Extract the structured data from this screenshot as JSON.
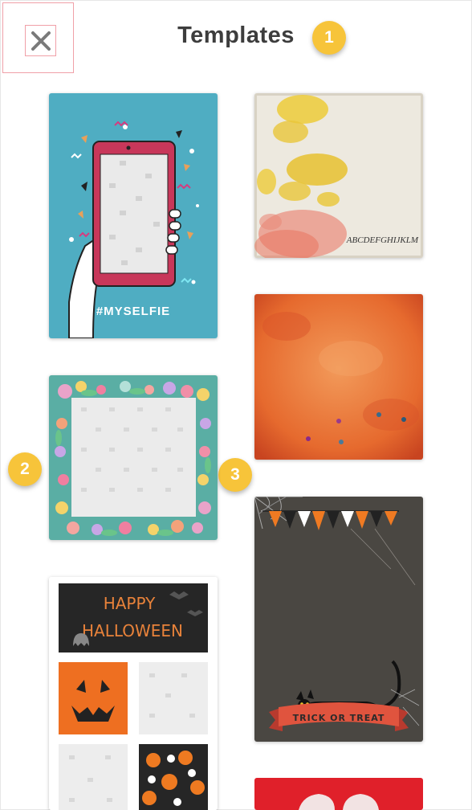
{
  "header": {
    "title": "Templates",
    "close_icon": "close-icon"
  },
  "badges": [
    "1",
    "2",
    "3"
  ],
  "templates": [
    {
      "id": "myselfie",
      "text": "#MYSELFIE",
      "bg": "#4fadc2"
    },
    {
      "id": "watercolor-alphabet",
      "text": "ABCDEFGHIJKLM",
      "bg": "#ede9df"
    },
    {
      "id": "floral-frame",
      "bg": "#5aaea4"
    },
    {
      "id": "orange-grunge",
      "bg": "#e0632a"
    },
    {
      "id": "happy-halloween-collage",
      "text_line1": "HAPPY",
      "text_line2": "HALLOWEEN",
      "bg": "#ffffff"
    },
    {
      "id": "trick-or-treat",
      "text": "TRICK OR TREAT",
      "bg": "#4a4742"
    },
    {
      "id": "red-template",
      "bg": "#e0202a"
    }
  ]
}
